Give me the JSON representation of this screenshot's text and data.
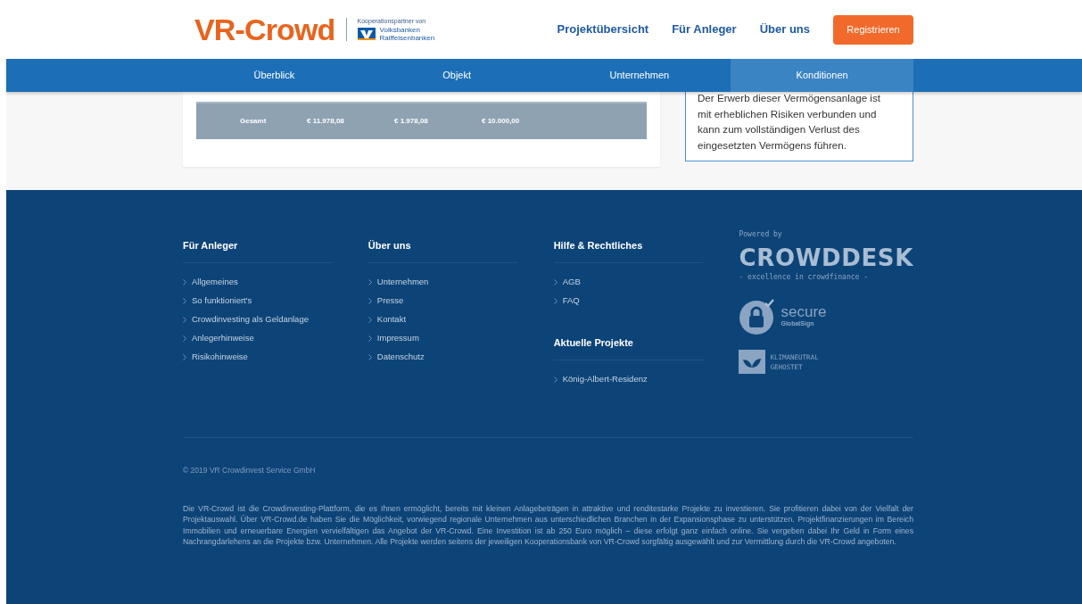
{
  "header": {
    "logo": "VR-Crowd",
    "partner_caption": "Kooperationspartner von",
    "partner_name": [
      "Volksbanken",
      "Raiffeisenbanken"
    ],
    "nav": [
      "Projektübersicht",
      "Für Anleger",
      "Über uns"
    ],
    "register_button": "Registrieren"
  },
  "tabs": [
    {
      "label": "Überblick",
      "selected": false
    },
    {
      "label": "Objekt",
      "selected": false
    },
    {
      "label": "Unternehmen",
      "selected": false
    },
    {
      "label": "Konditionen",
      "selected": true
    }
  ],
  "summary_row": [
    "Gesamt",
    "€ 11.978,08",
    "€ 1.978,08",
    "€ 10.000,00"
  ],
  "risk_notice": "Der Erwerb dieser Vermögensanlage ist mit erheblichen Risiken verbunden und kann zum vollständigen Verlust des eingesetzten Vermögens führen.",
  "footer": {
    "columns": [
      {
        "sections": [
          {
            "heading": "Für Anleger",
            "links": [
              "Allgemeines",
              "So funktioniert's",
              "Crowdinvesting als Geldanlage",
              "Anlegerhinweise",
              "Risikohinweise"
            ]
          }
        ]
      },
      {
        "sections": [
          {
            "heading": "Über uns",
            "links": [
              "Unternehmen",
              "Presse",
              "Kontakt",
              "Impressum",
              "Datenschutz"
            ]
          }
        ]
      },
      {
        "sections": [
          {
            "heading": "Hilfe & Rechtliches",
            "links": [
              "AGB",
              "FAQ"
            ]
          },
          {
            "heading": "Aktuelle Projekte",
            "links": [
              "König-Albert-Residenz"
            ]
          }
        ]
      }
    ],
    "powered_by": "Powered by",
    "crowddesk_logo": "CROWDDESK",
    "crowddesk_tagline": "- excellence in crowdfinance -",
    "secure_badge": {
      "title": "secure",
      "subtitle": "GlobalSign"
    },
    "climate_badge": [
      "KLIMANEUTRAL",
      "GEHOSTET"
    ],
    "copyright": "© 2019 VR Crowdinvest Service GmbH",
    "about": "Die VR-Crowd ist die Crowdinvesting-Plattform, die es Ihnen ermöglicht, bereits mit kleinen Anlagebeträgen in attraktive und renditestarke Projekte zu investieren. Sie profitieren dabei von der Vielfalt der Projektauswahl. Über VR-Crowd.de haben Sie die Möglichkeit, vorwiegend regionale Unternehmen aus unterschiedlichen Branchen in der Expansionsphase zu unterstützen. Projektfinanzierungen im Bereich Immobilien und erneuerbare Energien vervielfältigen das Angebot der VR-Crowd. Eine Investition ist ab 250 Euro möglich – diese erfolgt ganz einfach online. Sie vergeben dabei Ihr Geld in Form eines Nachrangdarlehens an die Projekte bzw. Unternehmen. Alle Projekte werden seitens der jeweiligen Kooperationsbank von VR-Crowd sorgfältig ausgewählt und zur Vermittlung durch die VR-Crowd angeboten."
  }
}
